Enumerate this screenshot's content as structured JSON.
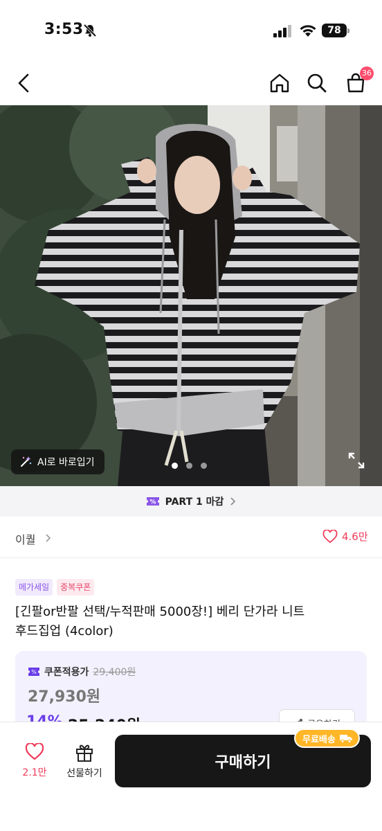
{
  "status_bar": {
    "time": "3:53",
    "battery": "78"
  },
  "nav": {
    "cart_count": "36"
  },
  "hero": {
    "ai_button_label": "AI로 바로입기",
    "page_count": 3,
    "active_page": 1
  },
  "part_bar": {
    "label": "PART 1 마감"
  },
  "seller": {
    "name": "이퀄",
    "likes": "4.6만"
  },
  "badges": [
    "메가세일",
    "중복쿠폰"
  ],
  "product": {
    "title_line1": "[긴팔or반팔 선택/누적판매 5000장!] 베리 단가라 니트",
    "title_line2": "후드집업 (4color)"
  },
  "price": {
    "coupon_label": "쿠폰적용가",
    "original": "29,400원",
    "price": "27,930원",
    "discount": "14%",
    "final": "25,240원",
    "share_label": "공유하기"
  },
  "bottom_bar": {
    "likes": "2.1만",
    "gift_label": "선물하기",
    "buy_label": "구매하기",
    "free_shipping_label": "무료배송"
  },
  "colors": {
    "accent_purple": "#6a3de8",
    "like_red": "#ef3b5a",
    "buy_button": "#171717",
    "free_ship": "#ffb627"
  },
  "icons": [
    "bell-slash-icon",
    "signal-icon",
    "wifi-icon",
    "battery-icon",
    "back-arrow-icon",
    "home-icon",
    "search-icon",
    "shopping-bag-icon",
    "magic-wand-icon",
    "expand-icon",
    "ticket-icon",
    "chevron-right-icon",
    "heart-icon",
    "gift-icon",
    "share-icon",
    "truck-icon"
  ]
}
